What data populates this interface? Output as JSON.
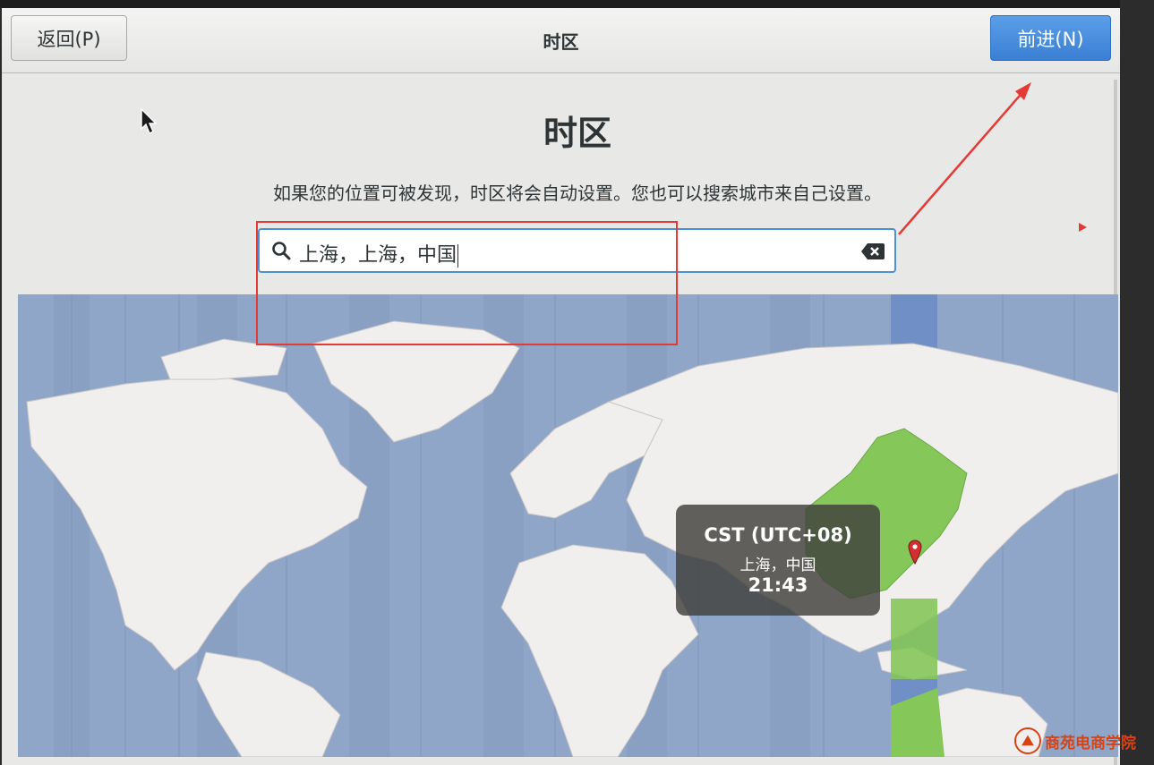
{
  "header": {
    "back_label": "返回(P)",
    "title": "时区",
    "next_label": "前进(N)"
  },
  "page": {
    "title": "时区",
    "subtitle": "如果您的位置可被发现，时区将会自动设置。您也可以搜索城市来自己设置。"
  },
  "search": {
    "value": "上海，上海，中国",
    "icon": "search-icon",
    "clear_icon": "clear-icon"
  },
  "map": {
    "ocean_color": "#90a6c8",
    "land_color": "#f1eeee",
    "selected_zone_color": "#86c75a",
    "tooltip": {
      "zone": "CST (UTC+08)",
      "place": "上海，中国",
      "time": "21:43"
    }
  },
  "annotation": {
    "color": "#e53935"
  },
  "watermark": {
    "text": "商苑电商学院"
  }
}
